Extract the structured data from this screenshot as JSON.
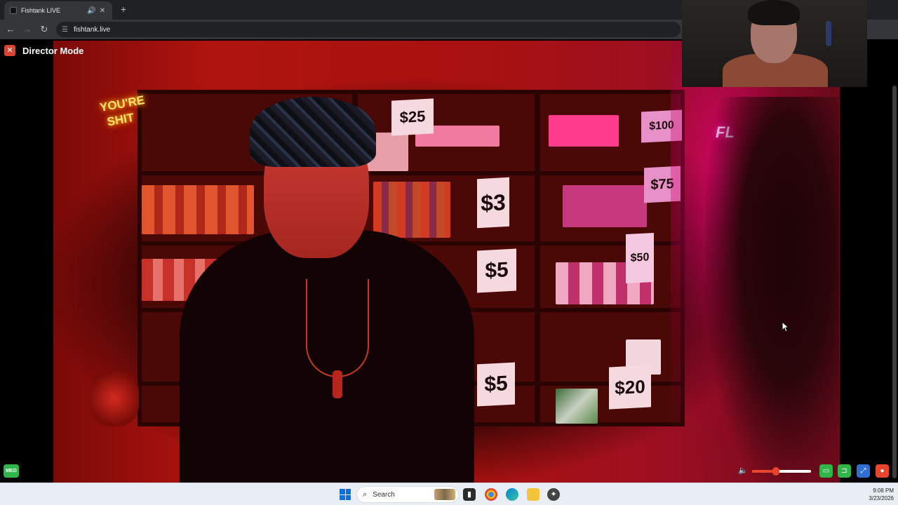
{
  "browser": {
    "tab_title": "Fishtank LIVE",
    "url": "fishtank.live",
    "icons": [
      "speaker-icon",
      "close-icon",
      "plus-icon",
      "back-icon",
      "forward-icon",
      "reload-icon",
      "site-settings-icon"
    ]
  },
  "page": {
    "director_label": "Director Mode",
    "close_glyph": "✕",
    "med_badge": "MED",
    "volume_level": 0.4
  },
  "video": {
    "neon_left": "YOU'RE SHIT",
    "neon_right": "FL",
    "price_tags": [
      "$25",
      "$3",
      "$5",
      "$5",
      "$20",
      "$75",
      "$100",
      "$50"
    ]
  },
  "taskbar": {
    "search_label": "Search",
    "time": "9:08 PM",
    "date": "3/23/2026"
  },
  "colors": {
    "accent_red": "#e8452c",
    "green_controls": "#2fb54a",
    "blue_fullscreen": "#2f6fd1"
  }
}
